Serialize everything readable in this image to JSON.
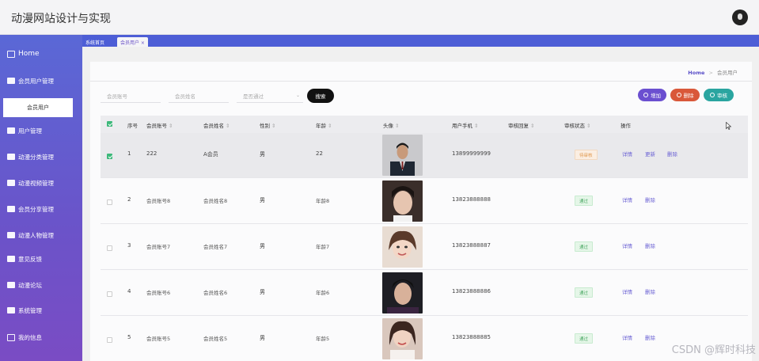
{
  "app": {
    "title": "动漫网站设计与实现"
  },
  "sidebar": {
    "home": "Home",
    "items": [
      {
        "label": "会员用户管理"
      },
      {
        "label": "用户管理"
      },
      {
        "label": "动漫分类管理"
      },
      {
        "label": "动漫视频管理"
      },
      {
        "label": "会员分享管理"
      },
      {
        "label": "动漫人物管理"
      },
      {
        "label": "意见反馈"
      },
      {
        "label": "动漫论坛"
      },
      {
        "label": "系统管理"
      },
      {
        "label": "我的信息"
      }
    ],
    "sub_active": "会员用户"
  },
  "tabs": [
    {
      "label": "系统首页"
    },
    {
      "label": "会员用户 ×"
    }
  ],
  "breadcrumb": {
    "home": "Home",
    "sep": ">",
    "current": "会员用户"
  },
  "search": {
    "account_placeholder": "会员账号",
    "name_placeholder": "会员姓名",
    "status_placeholder": "是否通过",
    "button": "搜索"
  },
  "actions": {
    "add": "增加",
    "delete": "删除",
    "review": "审核",
    "colors": {
      "add": "#6b4fd0",
      "delete": "#d9583a",
      "review": "#2aa5a0"
    }
  },
  "table": {
    "headers": [
      "序号",
      "会员账号",
      "会员姓名",
      "性别",
      "年龄",
      "头像",
      "用户手机",
      "审核回复",
      "审核状态",
      "操作"
    ],
    "sort_glyph": "⇕",
    "rows": [
      {
        "index": "1",
        "account": "222",
        "name": "A会员",
        "gender": "男",
        "age": "22",
        "phone": "13899999999",
        "status": "待审核",
        "ops": [
          "详情",
          "更新",
          "删除"
        ]
      },
      {
        "index": "2",
        "account": "会员账号8",
        "name": "会员姓名8",
        "gender": "男",
        "age": "年龄8",
        "phone": "13823888888",
        "status": "通过",
        "ops": [
          "详情",
          "删除"
        ]
      },
      {
        "index": "3",
        "account": "会员账号7",
        "name": "会员姓名7",
        "gender": "男",
        "age": "年龄7",
        "phone": "13823888887",
        "status": "通过",
        "ops": [
          "详情",
          "删除"
        ]
      },
      {
        "index": "4",
        "account": "会员账号6",
        "name": "会员姓名6",
        "gender": "男",
        "age": "年龄6",
        "phone": "13823888886",
        "status": "通过",
        "ops": [
          "详情",
          "删除"
        ]
      },
      {
        "index": "5",
        "account": "会员账号5",
        "name": "会员姓名5",
        "gender": "男",
        "age": "年龄5",
        "phone": "13823888885",
        "status": "通过",
        "ops": [
          "详情",
          "删除"
        ]
      }
    ]
  },
  "watermark": "CSDN @辉时科技"
}
